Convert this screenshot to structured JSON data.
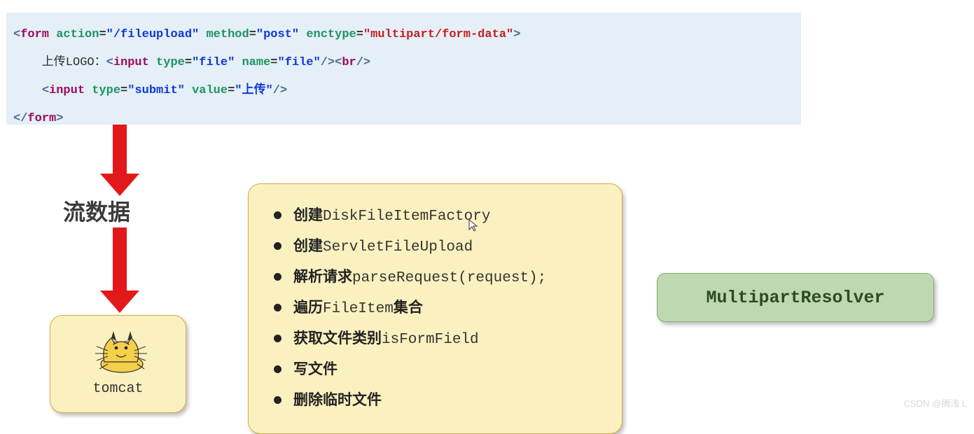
{
  "code": {
    "line1": {
      "tag_open": "form",
      "action_attr": "action",
      "action_val": "\"/fileupload\"",
      "method_attr": "method",
      "method_val": "\"post\"",
      "enctype_attr": "enctype",
      "enctype_val": "\"multipart/form-data\""
    },
    "line2": {
      "text_prefix": "    上传LOGO：",
      "input_tag": "input",
      "type_attr": "type",
      "type_val": "\"file\"",
      "name_attr": "name",
      "name_val": "\"file\"",
      "br_tag": "br"
    },
    "line3": {
      "input_tag": "input",
      "type_attr": "type",
      "type_val": "\"submit\"",
      "value_attr": "value",
      "value_val": "\"上传\""
    },
    "line4": {
      "tag_close": "form"
    }
  },
  "flow_label": "流数据",
  "tomcat_label": "tomcat",
  "steps": [
    {
      "bold": "创建",
      "mono": "DiskFileItemFactory"
    },
    {
      "bold": "创建",
      "mono": "ServletFileUpload"
    },
    {
      "bold": "解析请求",
      "mono": "parseRequest(request);"
    },
    {
      "bold": "遍历",
      "mono": "FileItem",
      "bold2": "集合"
    },
    {
      "bold": "获取文件类别",
      "mono": "isFormField"
    },
    {
      "bold": "写文件",
      "mono": ""
    },
    {
      "bold": "删除临时文件",
      "mono": ""
    }
  ],
  "resolver_label": "MultipartResolver",
  "watermark": "CSDN @搁浅  L"
}
